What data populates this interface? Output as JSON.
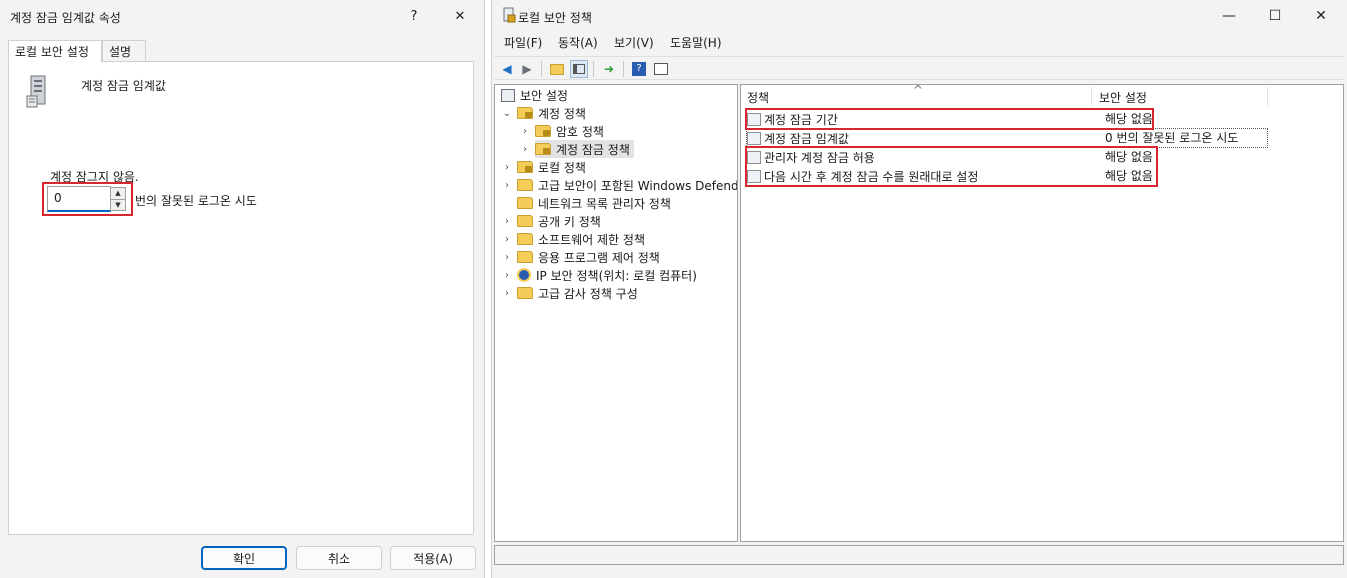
{
  "dialog": {
    "title": "계정 잠금 임계값 속성",
    "help_label": "?",
    "close_label": "✕",
    "tabs": [
      {
        "label": "로컬 보안 설정"
      },
      {
        "label": "설명"
      }
    ],
    "policy_name": "계정 잠금 임계값",
    "status_text": "계정 잠그지 않음.",
    "threshold_value": "0",
    "threshold_suffix": "번의 잘못된 로그온 시도",
    "buttons": {
      "ok": "확인",
      "cancel": "취소",
      "apply": "적용(A)"
    }
  },
  "mmc": {
    "title": "로컬 보안 정책",
    "controls": {
      "minimize": "—",
      "maximize": "☐",
      "close": "✕"
    },
    "menu": [
      "파일(F)",
      "동작(A)",
      "보기(V)",
      "도움말(H)"
    ],
    "toolbar_icons": [
      "back-icon",
      "forward-icon",
      "up-folder-icon",
      "show-hide-tree-icon",
      "export-list-icon",
      "help-icon",
      "properties-icon"
    ],
    "tree": {
      "root": "보안 설정",
      "account_policies": "계정 정책",
      "password_policy": "암호 정책",
      "account_lockout_policy": "계정 잠금 정책",
      "local_policies": "로컬 정책",
      "windows_defender": "고급 보안이 포함된 Windows Defender",
      "network_list": "네트워크 목록 관리자 정책",
      "public_key": "공개 키 정책",
      "software_restriction": "소프트웨어 제한 정책",
      "app_control": "응용 프로그램 제어 정책",
      "ip_security": "IP 보안 정책(위치: 로컬 컴퓨터)",
      "advanced_audit": "고급 감사 정책 구성"
    },
    "list": {
      "sort_indicator": "^",
      "columns": {
        "policy": "정책",
        "setting": "보안 설정"
      },
      "rows": [
        {
          "policy": "계정 잠금 기간",
          "setting": "해당 없음"
        },
        {
          "policy": "계정 잠금 임계값",
          "setting": "0 번의 잘못된 로그온 시도"
        },
        {
          "policy": "관리자 계정 잠금 허용",
          "setting": "해당 없음"
        },
        {
          "policy": "다음 시간 후 계정 잠금 수를 원래대로 설정",
          "setting": "해당 없음"
        }
      ]
    },
    "highlight_color": "#d8262f",
    "accent_color": "#0067c0"
  }
}
